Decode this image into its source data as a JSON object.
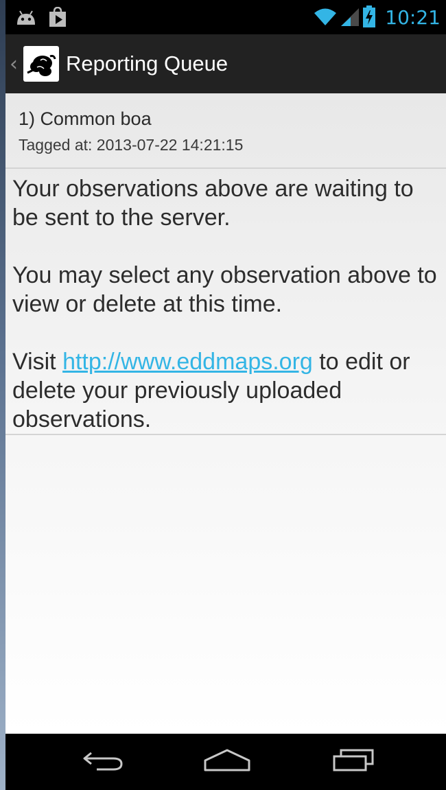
{
  "status_bar": {
    "time": "10:21",
    "icons": [
      "android-debug-icon",
      "play-store-icon",
      "wifi-icon",
      "signal-icon",
      "battery-charging-icon"
    ]
  },
  "action_bar": {
    "title": "Reporting Queue",
    "up_icon": "chevron-left-icon",
    "logo_icon": "snake-logo-icon"
  },
  "queue": {
    "items": [
      {
        "title": "1) Common boa",
        "subtitle": "Tagged at: 2013-07-22 14:21:15"
      }
    ]
  },
  "info": {
    "paragraph1": "Your observations above are waiting to be sent to the server.",
    "paragraph2": "You may select any observation above to view or delete at this time.",
    "paragraph3_prefix": "Visit ",
    "link": "http://www.eddmaps.org",
    "paragraph3_suffix": " to edit or delete your previously uploaded observations."
  },
  "nav_bar": {
    "buttons": [
      "back-icon",
      "home-icon",
      "recent-apps-icon"
    ]
  },
  "colors": {
    "accent": "#33b5e5",
    "action_bar": "#222222",
    "status_bar": "#000000"
  }
}
